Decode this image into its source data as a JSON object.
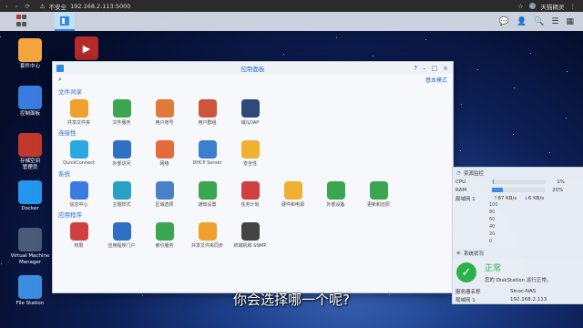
{
  "browser": {
    "insecure_label": "不安全",
    "url": "192.168.2.113:5000",
    "user": "天猫精灵"
  },
  "desktop_icons": [
    {
      "label": "套件中心",
      "color": "#f3a43a"
    },
    {
      "label": "控制面板",
      "color": "#3a7be0"
    },
    {
      "label": "存储空间\n管理员",
      "color": "#c0392b"
    },
    {
      "label": "Docker",
      "color": "#2496ed"
    },
    {
      "label": "Virtual Machine\nManager",
      "color": "#4a5b78"
    },
    {
      "label": "File Station",
      "color": "#3a8de0"
    }
  ],
  "video_icon": {
    "color": "#b52a2a"
  },
  "control_panel": {
    "title": "控制面板",
    "mode_label": "基本模式",
    "sections": [
      {
        "title": "文件共享",
        "items": [
          {
            "label": "共享文件夹",
            "color": "#f0a12d",
            "icon": "share-folder-icon"
          },
          {
            "label": "文件服务",
            "color": "#3aa650",
            "icon": "file-services-icon"
          },
          {
            "label": "用户账号",
            "color": "#e07a3a",
            "icon": "user-icon"
          },
          {
            "label": "用户群组",
            "color": "#d0543a",
            "icon": "group-icon"
          },
          {
            "label": "域/LDAP",
            "color": "#2e4a7a",
            "icon": "domain-ldap-icon"
          }
        ]
      },
      {
        "title": "连接性",
        "items": [
          {
            "label": "QuickConnect",
            "color": "#2aa8e0",
            "icon": "quickconnect-icon"
          },
          {
            "label": "外部访问",
            "color": "#2f6fc5",
            "icon": "external-access-icon"
          },
          {
            "label": "网络",
            "color": "#e66a3a",
            "icon": "network-icon"
          },
          {
            "label": "DHCP Server",
            "color": "#3c7fd0",
            "icon": "dhcp-icon"
          },
          {
            "label": "安全性",
            "color": "#f0b030",
            "icon": "security-icon"
          }
        ]
      },
      {
        "title": "系统",
        "items": [
          {
            "label": "信息中心",
            "color": "#3a7be0",
            "icon": "info-center-icon"
          },
          {
            "label": "主题样式",
            "color": "#28a0c8",
            "icon": "theme-icon"
          },
          {
            "label": "区域选项",
            "color": "#4a80c8",
            "icon": "regional-icon"
          },
          {
            "label": "通知设置",
            "color": "#3aa650",
            "icon": "notification-icon"
          },
          {
            "label": "任务计划",
            "color": "#d04040",
            "icon": "task-scheduler-icon"
          },
          {
            "label": "硬件和电源",
            "color": "#f0b030",
            "icon": "hardware-power-icon"
          },
          {
            "label": "外部设备",
            "color": "#3aa650",
            "icon": "external-devices-icon"
          },
          {
            "label": "更新和还原",
            "color": "#3aa650",
            "icon": "update-restore-icon"
          }
        ]
      },
      {
        "title": "应用程序",
        "items": [
          {
            "label": "权限",
            "color": "#d04040",
            "icon": "privileges-icon"
          },
          {
            "label": "应用程序门户",
            "color": "#2f6fc5",
            "icon": "app-portal-icon"
          },
          {
            "label": "索引服务",
            "color": "#3aa650",
            "icon": "indexing-icon"
          },
          {
            "label": "共享文件夹同步",
            "color": "#f0a12d",
            "icon": "shared-folder-sync-icon"
          },
          {
            "label": "终端机和 SNMP",
            "color": "#444",
            "icon": "terminal-snmp-icon"
          }
        ]
      }
    ]
  },
  "resource_monitor": {
    "title": "资源监控",
    "cpu_label": "CPU",
    "cpu_value": "1%",
    "cpu_fraction": 0.01,
    "ram_label": "RAM",
    "ram_value": "20%",
    "ram_fraction": 0.2,
    "lan_label": "局域网 1",
    "upload": "87 KB/s",
    "download": "6 KB/s",
    "scale": [
      "100",
      "80",
      "60",
      "40",
      "20",
      "0"
    ]
  },
  "system_status": {
    "title": "系统状况",
    "status": "正常",
    "message": "您的 DiskStation 运行正常。",
    "server_name_label": "服务器名称",
    "server_name": "Sinoc-NAS",
    "lan_label": "局域网 1",
    "lan_ip": "192.168.2.113"
  },
  "subtitle": "你会选择哪一个呢?"
}
